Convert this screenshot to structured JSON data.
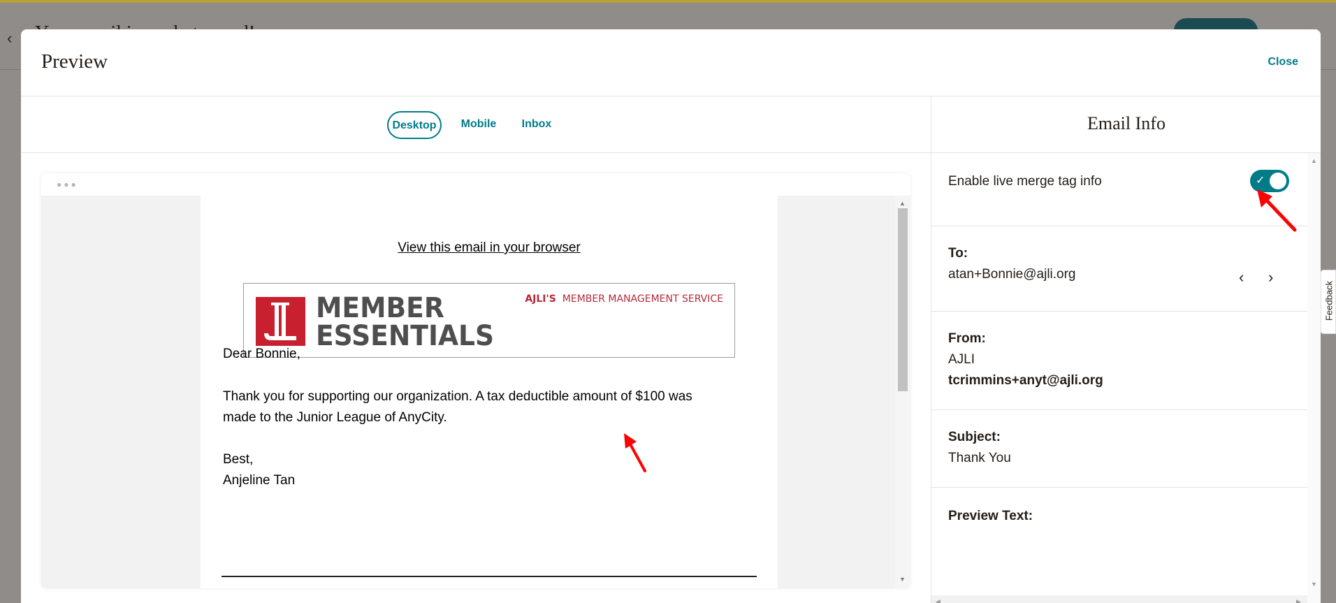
{
  "background": {
    "page_title": "Your email is ready to send!"
  },
  "modal": {
    "title": "Preview",
    "close_label": "Close"
  },
  "tabs": [
    {
      "label": "Desktop",
      "active": true
    },
    {
      "label": "Mobile",
      "active": false
    },
    {
      "label": "Inbox",
      "active": false
    }
  ],
  "email": {
    "view_in_browser": "View this email in your browser",
    "logo": {
      "line1": "MEMBER",
      "line2": "ESSENTIALS",
      "tag_bold": "AJLI'S",
      "tag_rest": "MEMBER MANAGEMENT SERVICE"
    },
    "greeting": "Dear Bonnie,",
    "body_line1": "Thank you for supporting our organization. A tax deductible amount of $100 was",
    "body_line2": "made to the Junior League of AnyCity.",
    "signoff": "Best,",
    "signature": "Anjeline Tan"
  },
  "email_info": {
    "title": "Email Info",
    "live_merge_label": "Enable live merge tag info",
    "live_merge_enabled": true,
    "to_label": "To:",
    "to_value": "atan+Bonnie@ajli.org",
    "from_label": "From:",
    "from_name": "AJLI",
    "from_email": "tcrimmins+anyt@ajli.org",
    "subject_label": "Subject:",
    "subject_value": "Thank You",
    "preview_text_label": "Preview Text:"
  },
  "feedback_label": "Feedback",
  "colors": {
    "accent": "#007c89",
    "annotation": "#ff0000",
    "logo_red": "#c8202f"
  }
}
